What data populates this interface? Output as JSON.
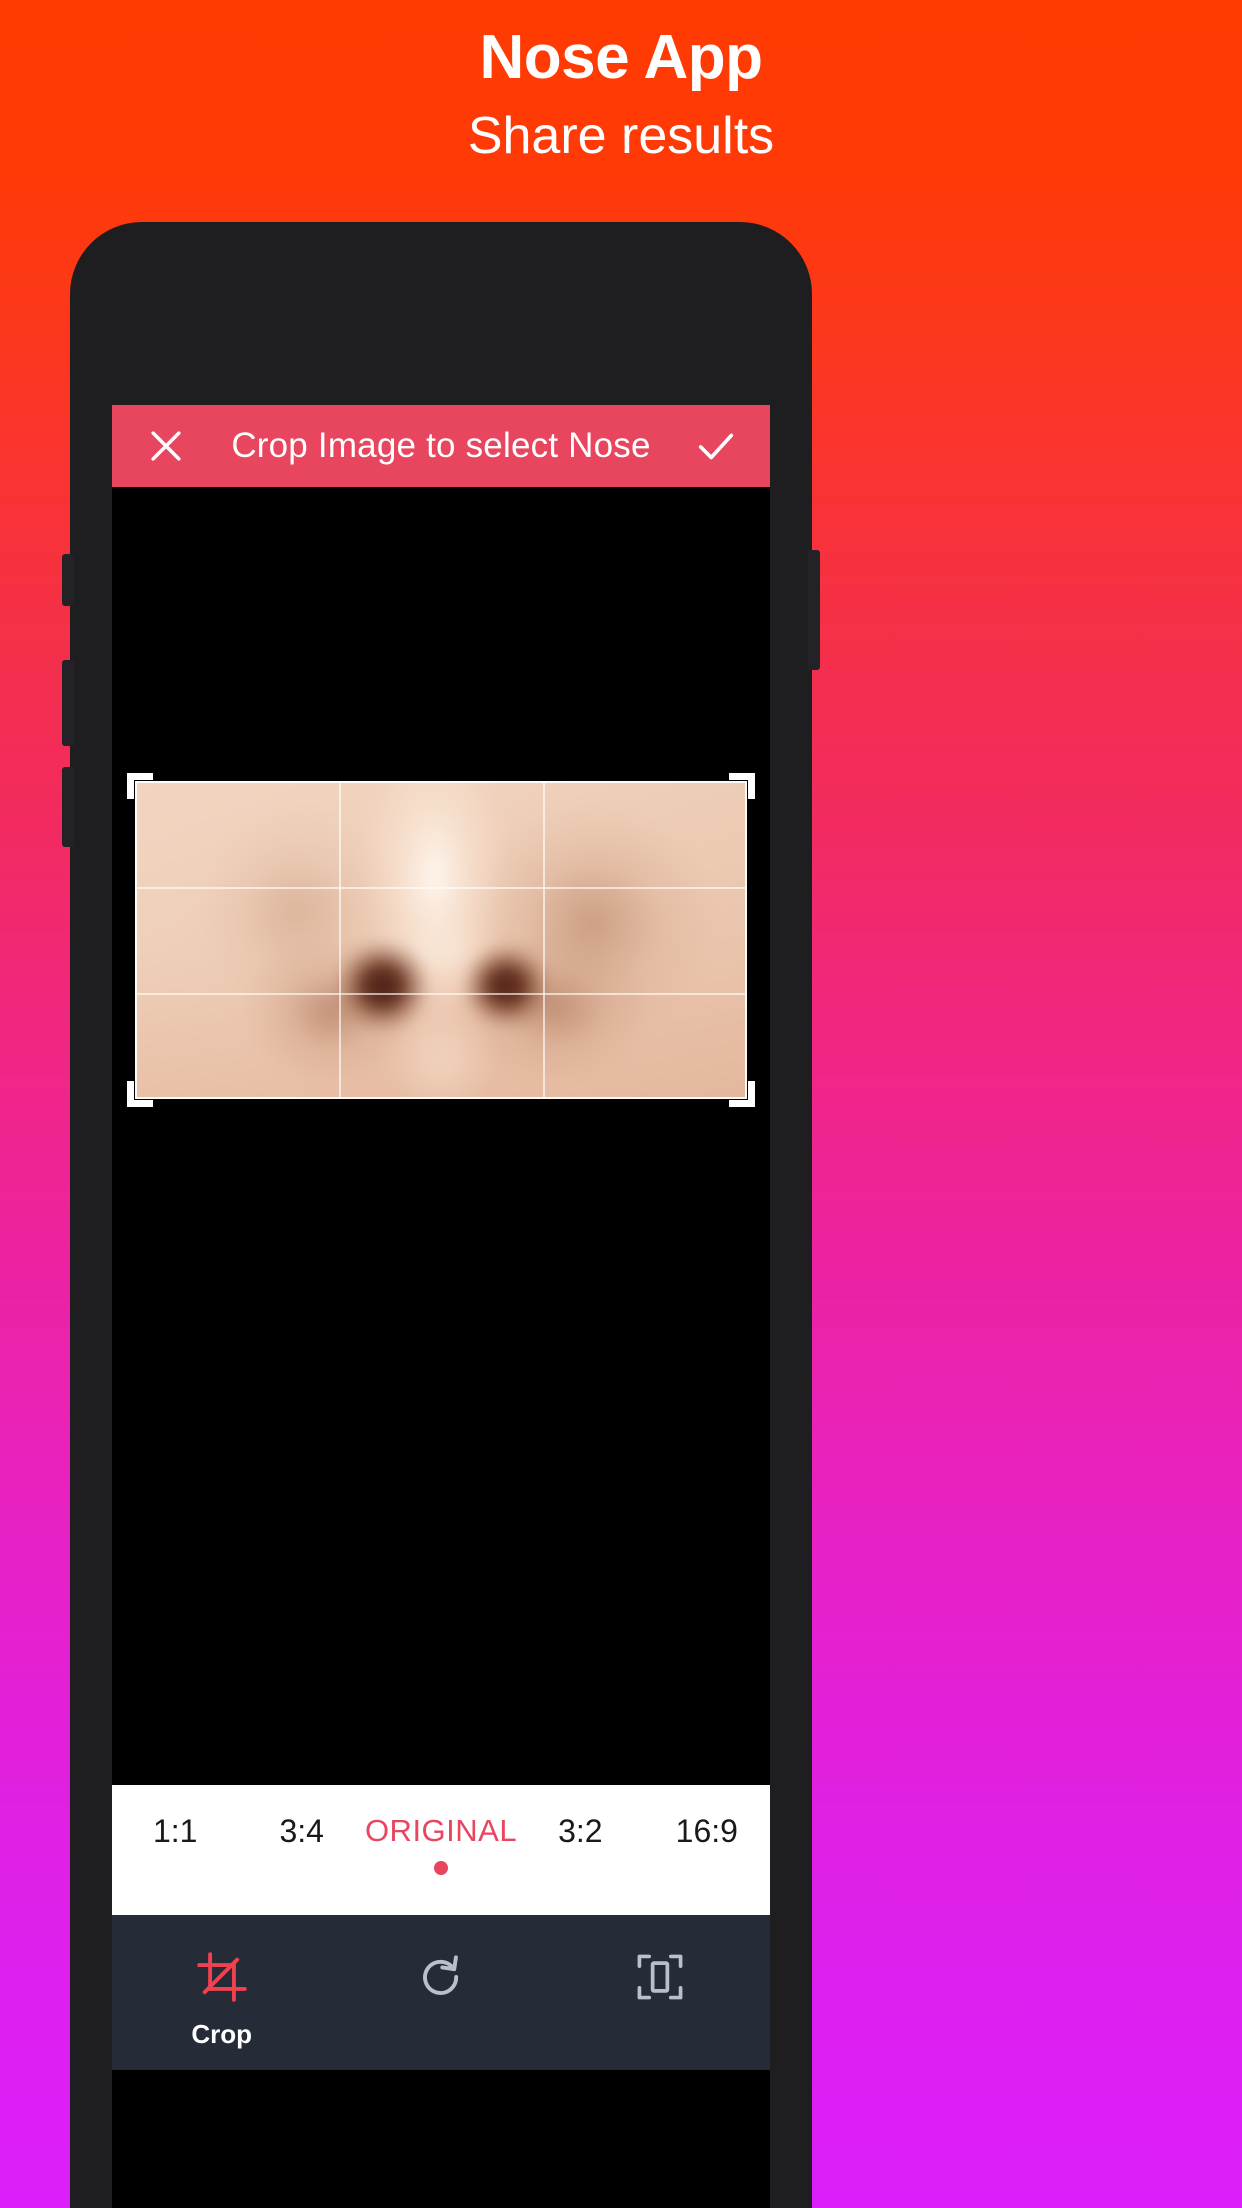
{
  "promo": {
    "title": "Nose App",
    "subtitle": "Share results"
  },
  "colors": {
    "gradient_top": "#FF3A00",
    "gradient_bottom": "#DC1EFA",
    "accent_red": "#E8455F",
    "toolbar_bg": "#262B38",
    "screen_bg": "#000000",
    "phone_body": "#1E1E21"
  },
  "app": {
    "header": {
      "close_icon": "close-x-icon",
      "title": "Crop Image to select Nose",
      "confirm_icon": "checkmark-icon"
    },
    "canvas": {
      "subject": "blurred-nose-closeup",
      "grid": "rule-of-thirds",
      "handles": [
        "top-left",
        "top-right",
        "bottom-left",
        "bottom-right"
      ]
    },
    "ratios": {
      "options": [
        {
          "label": "1:1",
          "selected": false
        },
        {
          "label": "3:4",
          "selected": false
        },
        {
          "label": "ORIGINAL",
          "selected": true
        },
        {
          "label": "3:2",
          "selected": false
        },
        {
          "label": "16:9",
          "selected": false
        }
      ]
    },
    "toolbar": {
      "items": [
        {
          "label": "Crop",
          "icon": "crop-icon",
          "active": true
        },
        {
          "label": "",
          "icon": "rotate-clockwise-icon",
          "active": false
        },
        {
          "label": "",
          "icon": "fit-frame-icon",
          "active": false
        }
      ]
    }
  }
}
